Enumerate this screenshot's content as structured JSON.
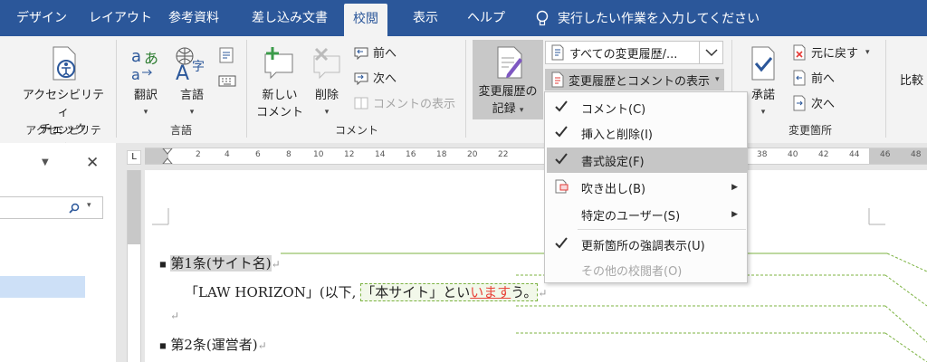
{
  "tabs": [
    "デザイン",
    "レイアウト",
    "参考資料",
    "差し込み文書",
    "校閲",
    "表示",
    "ヘルプ"
  ],
  "tell_me": "実行したい作業を入力してください",
  "ribbon": {
    "accessibility": {
      "button": [
        "アクセシビリティ",
        "チェック"
      ],
      "group": "アクセシビリティ"
    },
    "language": {
      "translate": "翻訳",
      "language": "言語",
      "group": "言語"
    },
    "comments": {
      "new": [
        "新しい",
        "コメント"
      ],
      "delete": "削除",
      "prev": "前へ",
      "next": "次へ",
      "show": "コメントの表示",
      "group": "コメント"
    },
    "tracking": {
      "track": [
        "変更履歴の",
        "記録"
      ],
      "combo": "すべての変更履歴/...",
      "show_markup": "変更履歴とコメントの表示"
    },
    "changes": {
      "accept": "承諾",
      "undo": "元に戻す",
      "prev": "前へ",
      "next": "次へ",
      "group": "変更箇所",
      "compare": "比較"
    }
  },
  "menu": {
    "items": [
      {
        "label": "コメント(C)",
        "checked": true,
        "submenu": false,
        "disabled": false
      },
      {
        "label": "挿入と削除(I)",
        "checked": true,
        "submenu": false,
        "disabled": false
      },
      {
        "label": "書式設定(F)",
        "checked": true,
        "submenu": false,
        "disabled": false
      },
      {
        "label": "吹き出し(B)",
        "checked": false,
        "submenu": true,
        "disabled": false
      },
      {
        "label": "特定のユーザー(S)",
        "checked": false,
        "submenu": true,
        "disabled": false
      },
      {
        "label": "更新箇所の強調表示(U)",
        "checked": true,
        "submenu": false,
        "disabled": false
      },
      {
        "label": "その他の校閲者(O)",
        "checked": false,
        "submenu": false,
        "disabled": true
      }
    ]
  },
  "ruler": {
    "ticks": [
      "2",
      "4",
      "6",
      "8",
      "10",
      "12",
      "14",
      "16",
      "18",
      "20",
      "22",
      "38",
      "40",
      "42",
      "44",
      "46",
      "48"
    ]
  },
  "document": {
    "art1": "第1条(サイト名)",
    "line1_a": "「LAW HORIZON」(以下,",
    "line1_b": "「本サイト」とい",
    "line1_c": "います",
    "line1_d": "う。",
    "art2": "第2条(運営者)"
  },
  "colors": {
    "accent": "#2b579a",
    "insertion": "#e8453c",
    "markup": "#7cb342"
  }
}
